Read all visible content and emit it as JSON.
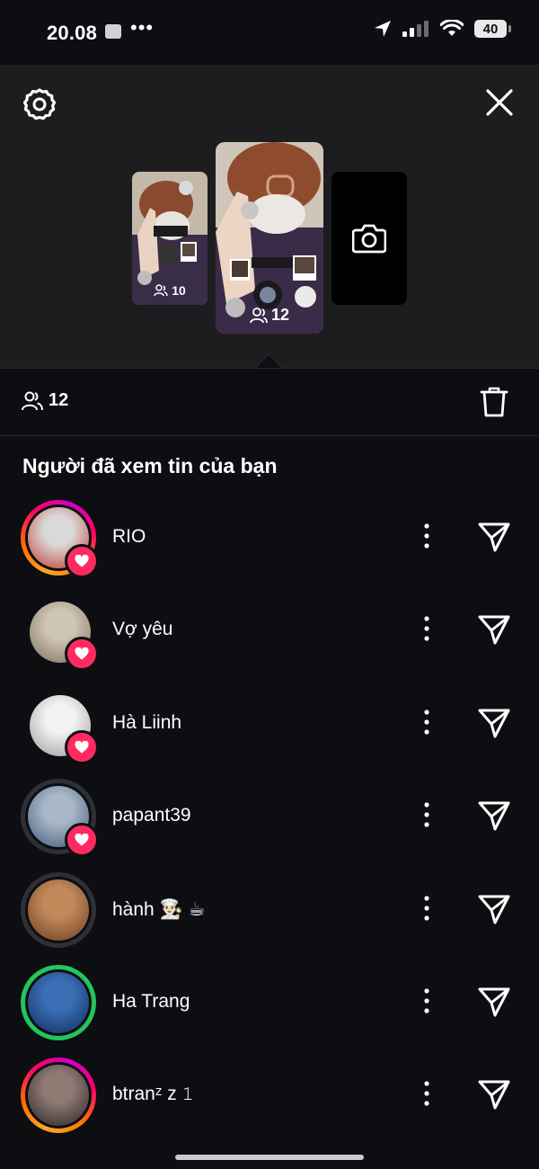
{
  "status_bar": {
    "time": "20.08",
    "dots": "•••",
    "battery": "40"
  },
  "icons": {
    "settings": "gear-icon",
    "close": "close-icon",
    "camera": "camera-icon",
    "viewers": "people-icon",
    "trash": "trash-icon",
    "more": "more-vertical-icon",
    "send": "send-icon",
    "heart": "heart-icon"
  },
  "stories": {
    "small_count": "10",
    "main_count": "12"
  },
  "summary": {
    "view_count": "12"
  },
  "section_title": "Người đã xem tin của bạn",
  "viewers": [
    {
      "name": "RIO",
      "ring": "gradient",
      "liked": true,
      "palette": [
        "#d9d9d9",
        "#c0392b"
      ]
    },
    {
      "name": "Vợ yêu",
      "ring": "none",
      "liked": true,
      "palette": [
        "#cfc5b3",
        "#7d6e5e"
      ]
    },
    {
      "name": "Hà Liinh",
      "ring": "none",
      "liked": true,
      "palette": [
        "#f2f2f2",
        "#9a9a9a"
      ]
    },
    {
      "name": "papant39",
      "ring": "gray",
      "liked": true,
      "palette": [
        "#a9b7c8",
        "#3e5a7a"
      ]
    },
    {
      "name": "hành 👨🏻‍🍳 ☕",
      "ring": "gray",
      "liked": false,
      "palette": [
        "#c28a5a",
        "#6b3d22"
      ]
    },
    {
      "name": "Ha Trang",
      "ring": "green",
      "liked": false,
      "palette": [
        "#3b6fb5",
        "#0f2c5a"
      ]
    },
    {
      "name": "btranᶻ z 𝟷",
      "ring": "gradient",
      "liked": false,
      "palette": [
        "#8f7b74",
        "#2a2224"
      ]
    }
  ],
  "colors": {
    "background": "#0d0e12",
    "top_panel": "#1d1d1f",
    "heart_badge": "#ff2a5f",
    "green_ring": "#22c55e"
  }
}
